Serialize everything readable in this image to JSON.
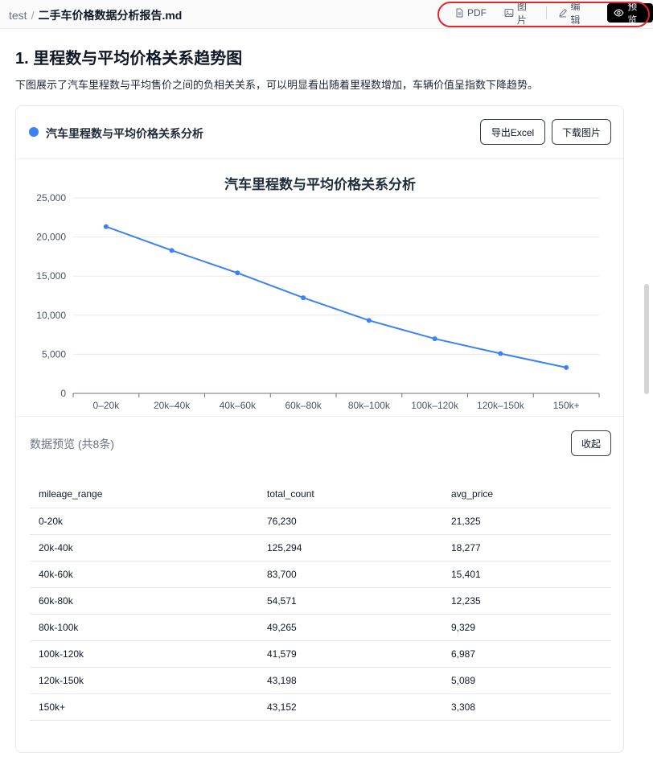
{
  "breadcrumb": {
    "root": "test",
    "separator": "/",
    "file": "二手车价格数据分析报告.md"
  },
  "toolbar": {
    "pdf": "PDF",
    "image": "图片",
    "edit": "编辑",
    "preview": "预览"
  },
  "content": {
    "heading": "1. 里程数与平均价格关系趋势图",
    "description": "下图展示了汽车里程数与平均售价之间的负相关关系，可以明显看出随着里程数增加，车辆价值呈指数下降趋势。"
  },
  "card": {
    "title": "汽车里程数与平均价格关系分析",
    "export_excel": "导出Excel",
    "download_image": "下载图片",
    "accent_color": "#3b82f6"
  },
  "chart_data": {
    "type": "line",
    "title": "汽车里程数与平均价格关系分析",
    "categories": [
      "0–20k",
      "20k–40k",
      "40k–60k",
      "60k–80k",
      "80k–100k",
      "100k–120k",
      "120k–150k",
      "150k+"
    ],
    "values": [
      21325,
      18277,
      15401,
      12235,
      9329,
      6987,
      5089,
      3308
    ],
    "yticks": [
      "0",
      "5,000",
      "10,000",
      "15,000",
      "20,000",
      "25,000"
    ],
    "ylim": [
      0,
      25000
    ],
    "grid": true,
    "color": "#3b82f6"
  },
  "preview": {
    "label": "数据预览 (共8条)",
    "collapse": "收起"
  },
  "table": {
    "headers": [
      "mileage_range",
      "total_count",
      "avg_price"
    ],
    "rows": [
      [
        "0-20k",
        "76,230",
        "21,325"
      ],
      [
        "20k-40k",
        "125,294",
        "18,277"
      ],
      [
        "40k-60k",
        "83,700",
        "15,401"
      ],
      [
        "60k-80k",
        "54,571",
        "12,235"
      ],
      [
        "80k-100k",
        "49,265",
        "9,329"
      ],
      [
        "100k-120k",
        "41,579",
        "6,987"
      ],
      [
        "120k-150k",
        "43,198",
        "5,089"
      ],
      [
        "150k+",
        "43,152",
        "3,308"
      ]
    ]
  }
}
